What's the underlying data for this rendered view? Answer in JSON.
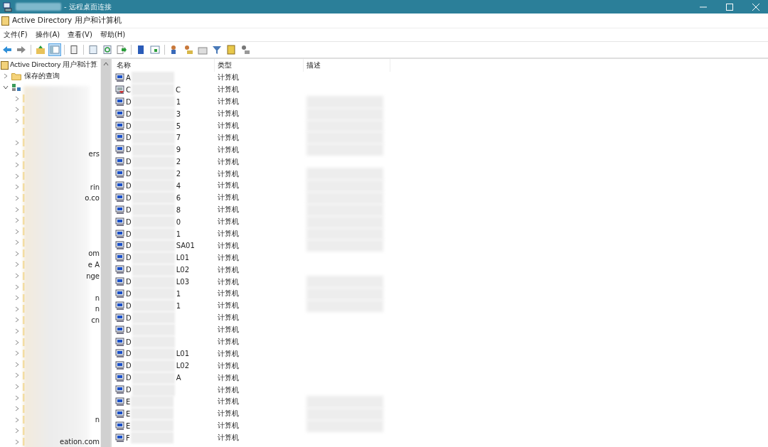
{
  "remote_window": {
    "title": "- 远程桌面连接"
  },
  "app": {
    "title": "Active Directory 用户和计算机"
  },
  "menu": [
    "文件(F)",
    "操作(A)",
    "查看(V)",
    "帮助(H)"
  ],
  "toolbar": [
    {
      "kind": "back",
      "pressed": false
    },
    {
      "kind": "forward",
      "pressed": false
    },
    {
      "kind": "sep"
    },
    {
      "kind": "up",
      "pressed": false
    },
    {
      "kind": "tree",
      "pressed": true
    },
    {
      "kind": "sep"
    },
    {
      "kind": "clipboard",
      "pressed": false
    },
    {
      "kind": "sep"
    },
    {
      "kind": "properties",
      "pressed": false
    },
    {
      "kind": "refresh",
      "pressed": false
    },
    {
      "kind": "export",
      "pressed": false
    },
    {
      "kind": "sep"
    },
    {
      "kind": "help",
      "pressed": false
    },
    {
      "kind": "view",
      "pressed": false
    },
    {
      "kind": "sep"
    },
    {
      "kind": "user",
      "pressed": false
    },
    {
      "kind": "group",
      "pressed": false
    },
    {
      "kind": "ou",
      "pressed": false
    },
    {
      "kind": "filter",
      "pressed": false
    },
    {
      "kind": "book",
      "pressed": false
    },
    {
      "kind": "delegate",
      "pressed": false
    }
  ],
  "tree": {
    "root": "Active Directory 用户和计算",
    "saved_queries": {
      "label": "保存的查询",
      "expanded": false
    },
    "domain": {
      "expanded": true,
      "children": [
        {
          "has_children": true
        },
        {
          "has_children": true
        },
        {
          "has_children": true
        },
        {
          "has_children": false
        },
        {
          "has_children": true
        },
        {
          "has_children": true,
          "suffix": "ers"
        },
        {
          "has_children": true
        },
        {
          "has_children": true
        },
        {
          "has_children": true,
          "suffix": "rin"
        },
        {
          "has_children": true,
          "suffix": "o.co"
        },
        {
          "has_children": true
        },
        {
          "has_children": true
        },
        {
          "has_children": true
        },
        {
          "has_children": true
        },
        {
          "has_children": true,
          "suffix": "om"
        },
        {
          "has_children": true,
          "suffix": "e A"
        },
        {
          "has_children": true,
          "suffix": "nge"
        },
        {
          "has_children": true
        },
        {
          "has_children": true,
          "suffix": "n"
        },
        {
          "has_children": true,
          "suffix": "n"
        },
        {
          "has_children": true,
          "suffix": "cn"
        },
        {
          "has_children": true
        },
        {
          "has_children": true
        },
        {
          "has_children": true
        },
        {
          "has_children": true
        },
        {
          "has_children": true
        },
        {
          "has_children": true
        },
        {
          "has_children": true
        },
        {
          "has_children": true
        },
        {
          "has_children": true,
          "suffix": "n"
        },
        {
          "has_children": true
        },
        {
          "has_children": true,
          "suffix": "eation.com"
        }
      ]
    }
  },
  "list": {
    "columns": [
      "名称",
      "类型",
      "描述"
    ],
    "rows": [
      {
        "name_start": "A",
        "type": "计算机",
        "disabled": false,
        "description_redacted": false
      },
      {
        "name_start": "C",
        "name_end": "C",
        "type": "计算机",
        "disabled": true,
        "description_redacted": false
      },
      {
        "name_start": "D",
        "name_end": "1",
        "type": "计算机",
        "disabled": false,
        "description_redacted": true
      },
      {
        "name_start": "D",
        "name_end": "3",
        "type": "计算机",
        "disabled": false,
        "description_redacted": true
      },
      {
        "name_start": "D",
        "name_end": "5",
        "type": "计算机",
        "disabled": false,
        "description_redacted": true
      },
      {
        "name_start": "D",
        "name_end": "7",
        "type": "计算机",
        "disabled": false,
        "description_redacted": true
      },
      {
        "name_start": "D",
        "name_end": "9",
        "type": "计算机",
        "disabled": false,
        "description_redacted": true
      },
      {
        "name_start": "D",
        "name_end": "2",
        "type": "计算机",
        "disabled": false,
        "description_redacted": false
      },
      {
        "name_start": "D",
        "name_end": "2",
        "type": "计算机",
        "disabled": false,
        "description_redacted": true
      },
      {
        "name_start": "D",
        "name_end": "4",
        "type": "计算机",
        "disabled": false,
        "description_redacted": true
      },
      {
        "name_start": "D",
        "name_end": "6",
        "type": "计算机",
        "disabled": false,
        "description_redacted": true
      },
      {
        "name_start": "D",
        "name_end": "8",
        "type": "计算机",
        "disabled": false,
        "description_redacted": true
      },
      {
        "name_start": "D",
        "name_end": "0",
        "type": "计算机",
        "disabled": false,
        "description_redacted": true
      },
      {
        "name_start": "D",
        "name_end": "1",
        "type": "计算机",
        "disabled": false,
        "description_redacted": true
      },
      {
        "name_start": "D",
        "name_end": "SA01",
        "type": "计算机",
        "disabled": false,
        "description_redacted": true
      },
      {
        "name_start": "D",
        "name_end": "L01",
        "type": "计算机",
        "disabled": false,
        "description_redacted": false
      },
      {
        "name_start": "D",
        "name_end": "L02",
        "type": "计算机",
        "disabled": false,
        "description_redacted": false
      },
      {
        "name_start": "D",
        "name_end": "L03",
        "type": "计算机",
        "disabled": false,
        "description_redacted": true
      },
      {
        "name_start": "D",
        "name_end": "1",
        "type": "计算机",
        "disabled": false,
        "description_redacted": true
      },
      {
        "name_start": "D",
        "name_end": "1",
        "type": "计算机",
        "disabled": false,
        "description_redacted": true
      },
      {
        "name_start": "D",
        "type": "计算机",
        "disabled": false,
        "description_redacted": false
      },
      {
        "name_start": "D",
        "type": "计算机",
        "disabled": false,
        "description_redacted": false
      },
      {
        "name_start": "D",
        "type": "计算机",
        "disabled": false,
        "description_redacted": false
      },
      {
        "name_start": "D",
        "name_end": "L01",
        "type": "计算机",
        "disabled": false,
        "description_redacted": false
      },
      {
        "name_start": "D",
        "name_end": "L02",
        "type": "计算机",
        "disabled": false,
        "description_redacted": false
      },
      {
        "name_start": "D",
        "name_end": "A",
        "type": "计算机",
        "disabled": false,
        "description_redacted": false
      },
      {
        "name_start": "D",
        "type": "计算机",
        "disabled": false,
        "description_redacted": false
      },
      {
        "name_start": "E",
        "type": "计算机",
        "disabled": false,
        "description_redacted": true
      },
      {
        "name_start": "E",
        "type": "计算机",
        "disabled": false,
        "description_redacted": true
      },
      {
        "name_start": "E",
        "type": "计算机",
        "disabled": false,
        "description_redacted": true
      },
      {
        "name_start": "F",
        "type": "计算机",
        "disabled": false,
        "description_redacted": false
      }
    ]
  }
}
